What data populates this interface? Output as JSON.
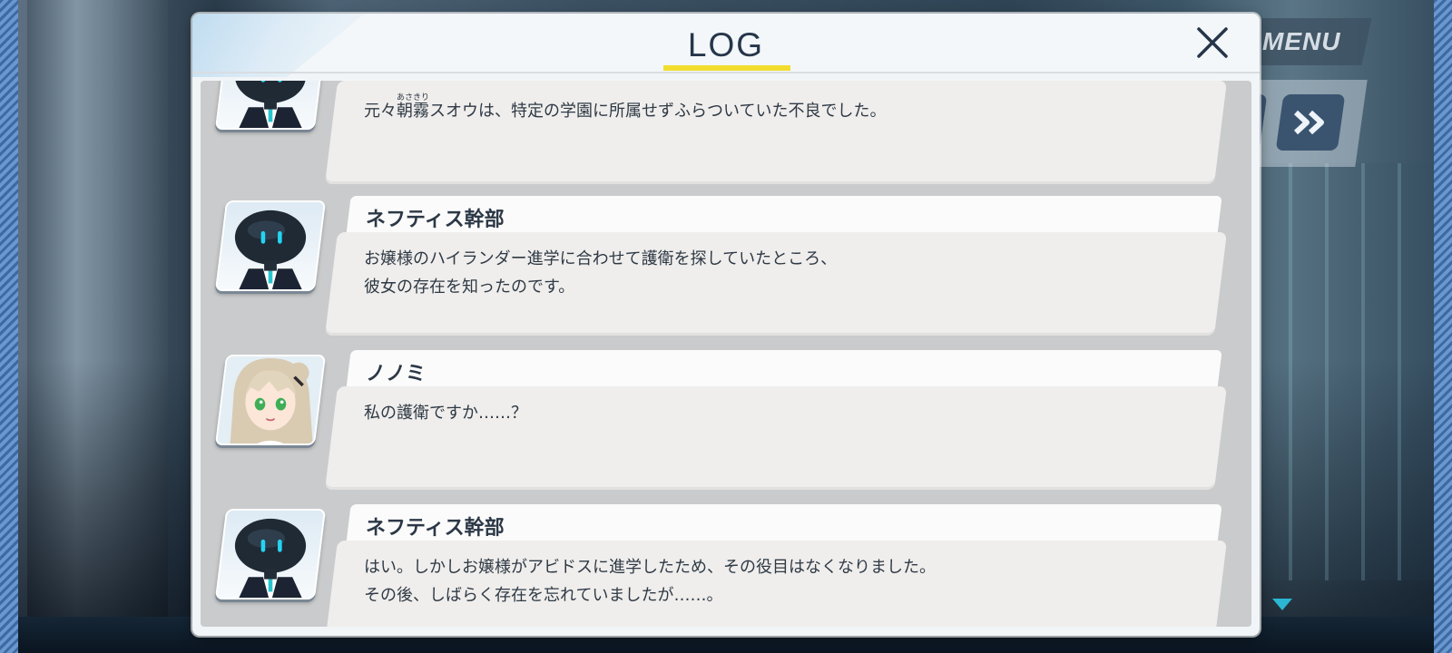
{
  "top_menu": {
    "menu_label": "MENU"
  },
  "log": {
    "title": "LOG",
    "entries": [
      {
        "speaker": "",
        "avatar": "robot-avatar",
        "line1_pre": "元々",
        "line1_ruby_base": "朝霧",
        "line1_ruby_text": "あさきり",
        "line1_post": "スオウは、特定の学園に所属せずふらついていた不良でした。"
      },
      {
        "speaker": "ネフティス幹部",
        "avatar": "robot-avatar",
        "line1": "お嬢様のハイランダー進学に合わせて護衛を探していたところ、",
        "line2": "彼女の存在を知ったのです。"
      },
      {
        "speaker": "ノノミ",
        "avatar": "nonomi-avatar",
        "line1": "私の護衛ですか……？"
      },
      {
        "speaker": "ネフティス幹部",
        "avatar": "robot-avatar",
        "line1": "はい。しかしお嬢様がアビドスに進学したため、その役目はなくなりました。",
        "line2": "その後、しばらく存在を忘れていましたが……。"
      }
    ]
  },
  "colors": {
    "title_underline": "#f2dd2e",
    "accent_text": "#26364a",
    "robot_eye": "#24d4f2",
    "skip_button": "#3a5470"
  }
}
